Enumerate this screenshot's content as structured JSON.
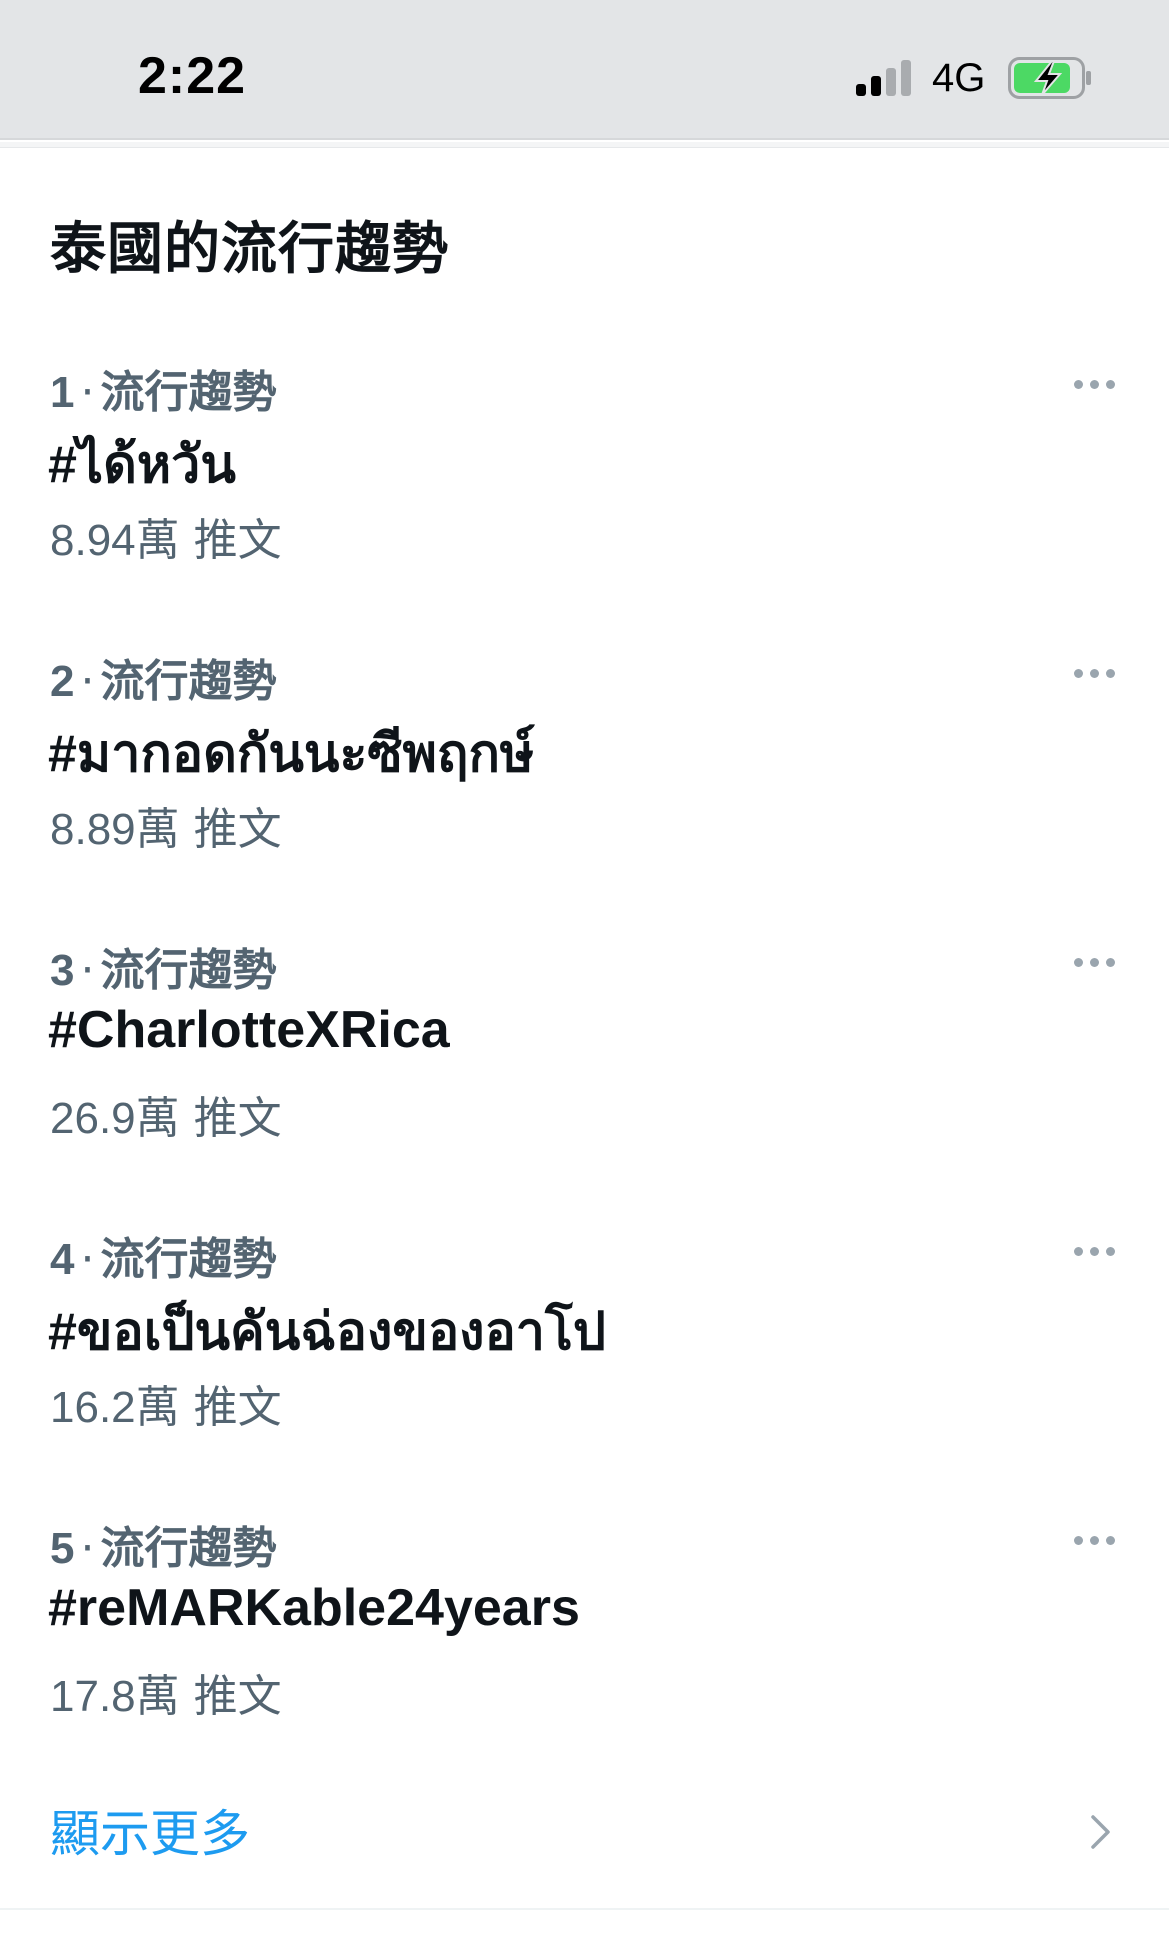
{
  "status_bar": {
    "time": "2:22",
    "network": "4G",
    "signal_icon": "cellular-signal-icon",
    "battery_icon": "battery-charging-icon",
    "battery_color": "#4cd964"
  },
  "section": {
    "title": "泰國的流行趨勢"
  },
  "trends": [
    {
      "rank": "1",
      "category": "流行趨勢",
      "name": "#ได้หวัน",
      "count": "8.94萬",
      "count_unit": "推文"
    },
    {
      "rank": "2",
      "category": "流行趨勢",
      "name": "#มากอดกันนะซีพฤกษ์",
      "count": "8.89萬",
      "count_unit": "推文"
    },
    {
      "rank": "3",
      "category": "流行趨勢",
      "name": "#CharlotteXRica",
      "count": "26.9萬",
      "count_unit": "推文"
    },
    {
      "rank": "4",
      "category": "流行趨勢",
      "name": "#ขอเป็นคันฉ่องของอาโป",
      "count": "16.2萬",
      "count_unit": "推文"
    },
    {
      "rank": "5",
      "category": "流行趨勢",
      "name": "#reMARKable24years",
      "count": "17.8萬",
      "count_unit": "推文"
    }
  ],
  "show_more": {
    "label": "顯示更多"
  },
  "colors": {
    "link": "#1d9bf0",
    "secondary_text": "#536471",
    "primary_text": "#0f1419"
  }
}
